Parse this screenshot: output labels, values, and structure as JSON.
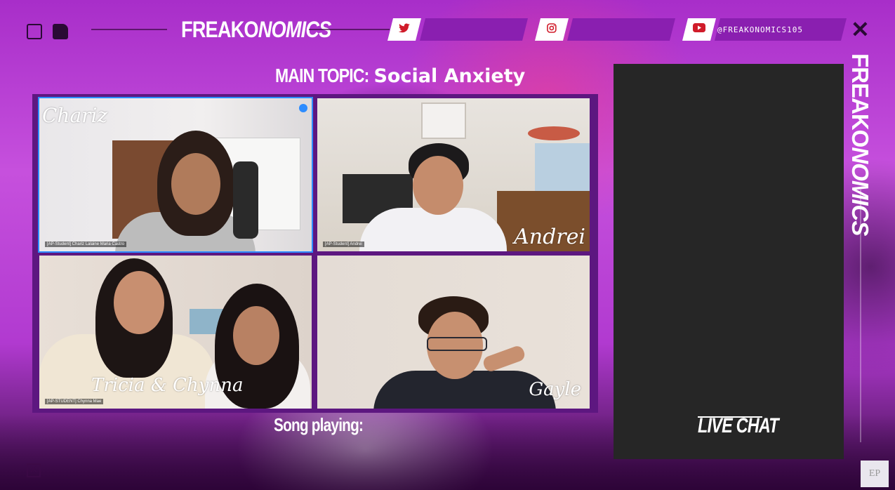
{
  "brand": {
    "part1": "FREAKO",
    "part2": "NOMICS"
  },
  "social": {
    "twitter_icon": "twitter-icon",
    "instagram_icon": "instagram-icon",
    "youtube_icon": "youtube-icon",
    "handle": "@FREAKONOMICS105"
  },
  "topic": {
    "label": "MAIN TOPIC:",
    "value": "Social Anxiety"
  },
  "participants": [
    {
      "overlay": "Chariz",
      "zoom_label": "[AP-Student] Chariz Lalaine Maria Castro"
    },
    {
      "overlay": "Andrei",
      "zoom_label": "[AP-Student] Andrei"
    },
    {
      "overlay": "Tricia & Chynna",
      "zoom_label": "[AP-STUDENT] Chynna Mae"
    },
    {
      "overlay": "Gayle",
      "zoom_label": ""
    }
  ],
  "song": {
    "label": "Song playing:"
  },
  "chat": {
    "label": "LIVE CHAT"
  },
  "watermark": "EP",
  "colors": {
    "accent": "#8a1fb0",
    "chat_bg": "#262626",
    "background": "#b23fcf"
  }
}
